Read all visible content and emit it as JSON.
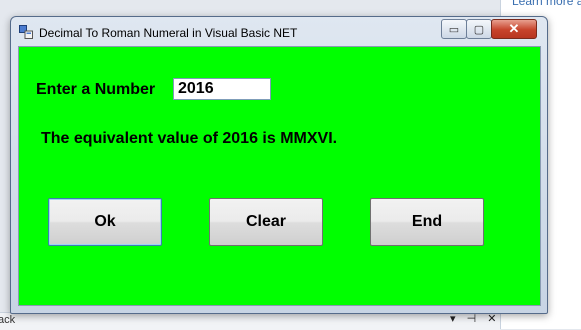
{
  "background": {
    "right_link": "Learn more a",
    "bottom_text": "ack",
    "bottom_controls": "▾ ⊣ ✕"
  },
  "window": {
    "title": "Decimal To Roman Numeral in Visual Basic NET",
    "controls": {
      "minimize": "▭",
      "maximize": "▢",
      "close": "✕"
    },
    "client_bg": "#00ff00"
  },
  "form": {
    "label": "Enter a Number",
    "input_value": "2016",
    "result_text": "The equivalent value of 2016 is MMXVI."
  },
  "buttons": {
    "ok": "Ok",
    "clear": "Clear",
    "end": "End"
  }
}
